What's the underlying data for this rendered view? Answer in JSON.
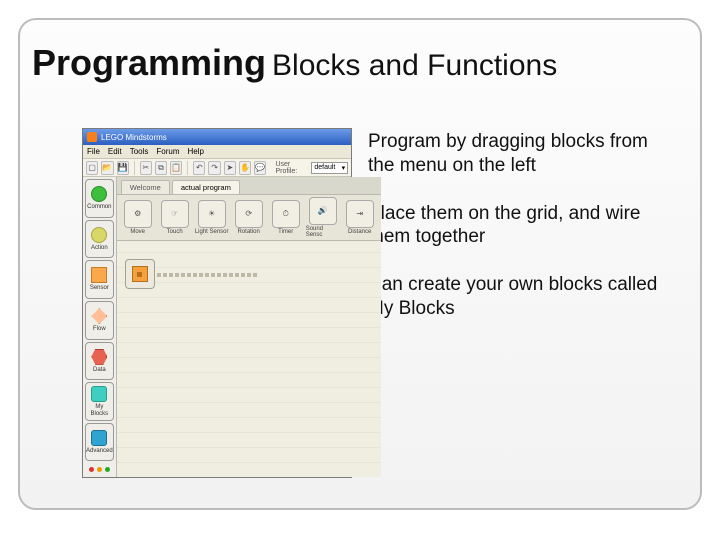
{
  "title": {
    "bold": "Programming",
    "rest": "Blocks and Functions"
  },
  "bullets": [
    "Program by dragging blocks from the menu on the left",
    "Place them on the grid, and wire them together",
    "Can create your own blocks called My Blocks"
  ],
  "app": {
    "title": "LEGO Mindstorms",
    "menus": [
      "File",
      "Edit",
      "Tools",
      "Forum",
      "Help"
    ],
    "toolbar": {
      "profile_label": "User Profile:",
      "profile_value": "default"
    },
    "palette": [
      {
        "label": "Common"
      },
      {
        "label": "Action"
      },
      {
        "label": "Sensor"
      },
      {
        "label": "Flow"
      },
      {
        "label": "Data"
      },
      {
        "label": "My Blocks"
      },
      {
        "label": "Advanced"
      }
    ],
    "tabs": [
      {
        "label": "Welcome",
        "active": false
      },
      {
        "label": "actual program",
        "active": true
      }
    ],
    "block_tray": [
      "Move",
      "Touch",
      "Light Sensor",
      "Rotation",
      "Timer",
      "Sound Sensc",
      "Distance"
    ]
  }
}
